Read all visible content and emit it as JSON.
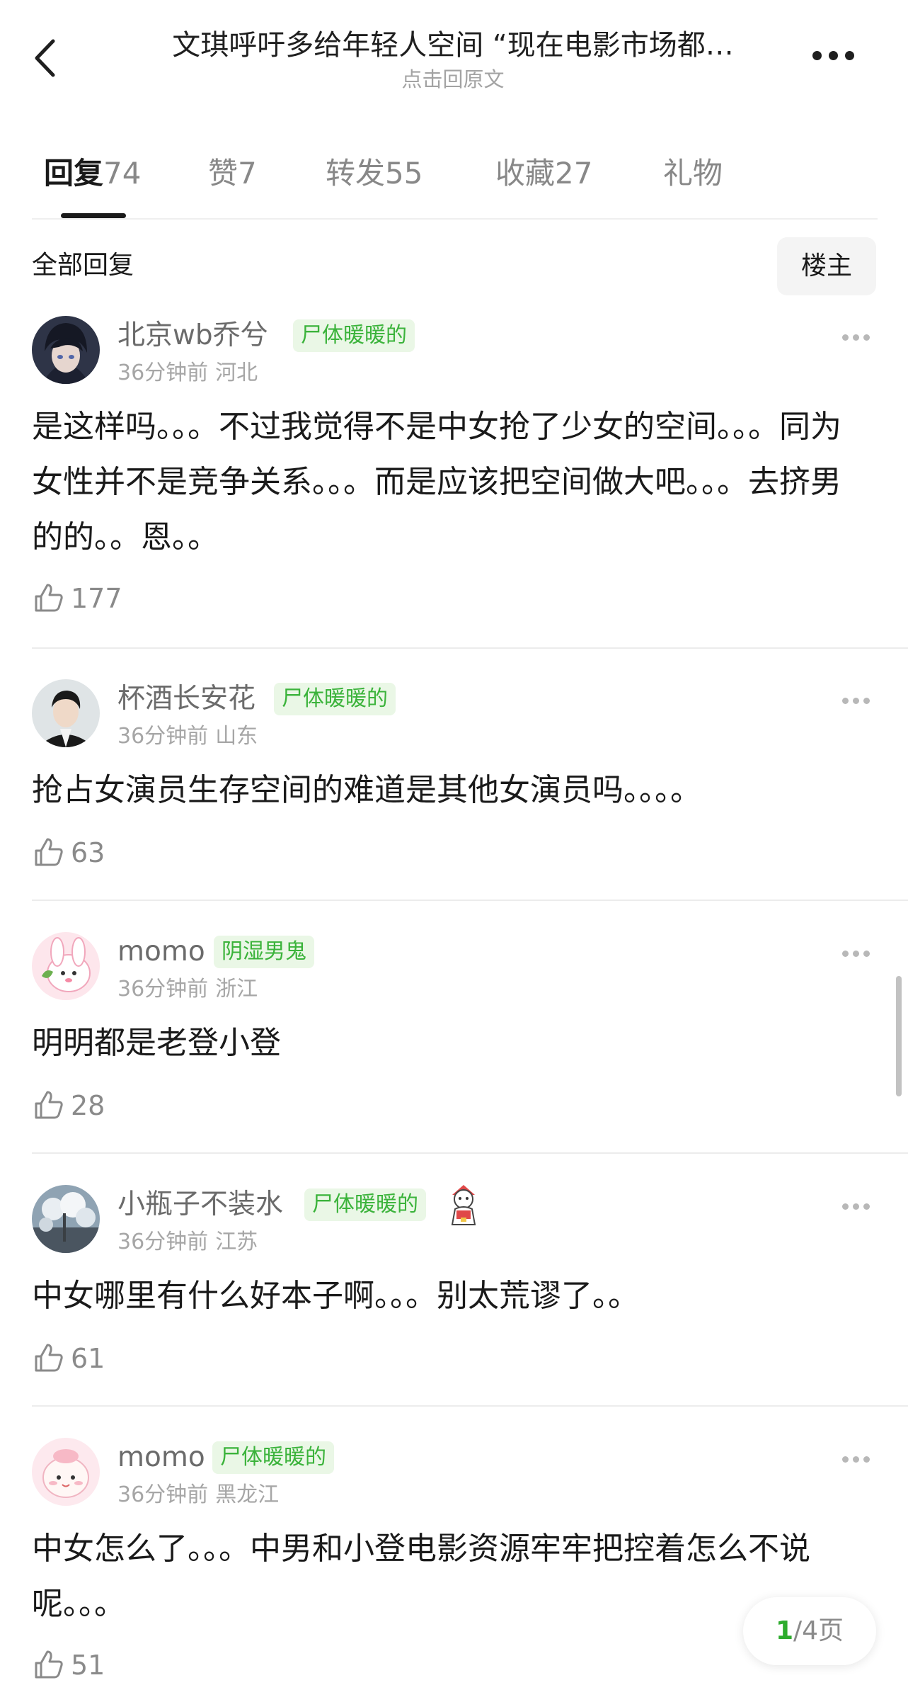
{
  "header": {
    "title": "文琪呼吁多给年轻人空间 “现在电影市场都…",
    "subtitle": "点击回原文",
    "back_icon": "chevron-left-icon",
    "more_icon": "more-dots-icon"
  },
  "tabs": [
    {
      "label": "回复",
      "count": "74",
      "active": true
    },
    {
      "label": "赞",
      "count": "7",
      "active": false
    },
    {
      "label": "转发",
      "count": "55",
      "active": false
    },
    {
      "label": "收藏",
      "count": "27",
      "active": false
    },
    {
      "label": "礼物",
      "count": "",
      "active": false
    }
  ],
  "filter": {
    "label": "全部回复",
    "owner_button": "楼主"
  },
  "comments": [
    {
      "username": "北京wb乔兮",
      "tag": "尸体暖暖的",
      "time": "36分钟前",
      "location": "河北",
      "text": "是这样吗。。。不过我觉得不是中女抢了少女的空间。。。同为女性并不是竞争关系。。。而是应该把空间做大吧。。。去挤男的的。。恩。。",
      "likes": "177"
    },
    {
      "username": "杯酒长安花",
      "tag": "尸体暖暖的",
      "time": "36分钟前",
      "location": "山东",
      "text": "抢占女演员生存空间的难道是其他女演员吗。。。。",
      "likes": "63"
    },
    {
      "username": "momo",
      "tag": "阴湿男鬼",
      "time": "36分钟前",
      "location": "浙江",
      "text": "明明都是老登小登",
      "likes": "28"
    },
    {
      "username": "小瓶子不装水",
      "tag": "尸体暖暖的",
      "time": "36分钟前",
      "location": "江苏",
      "text": "中女哪里有什么好本子啊。。。别太荒谬了。。",
      "likes": "61"
    },
    {
      "username": "momo",
      "tag": "尸体暖暖的",
      "time": "36分钟前",
      "location": "黑龙江",
      "text": "中女怎么了。。。中男和小登电影资源牢牢把控着怎么不说呢。。。",
      "likes": "51"
    }
  ],
  "pager": {
    "current": "1",
    "total_text": "/4页"
  },
  "colors": {
    "tag_green": "#3bb33b",
    "tag_bg": "#eaf7e6",
    "pager_green": "#2eac2e"
  }
}
